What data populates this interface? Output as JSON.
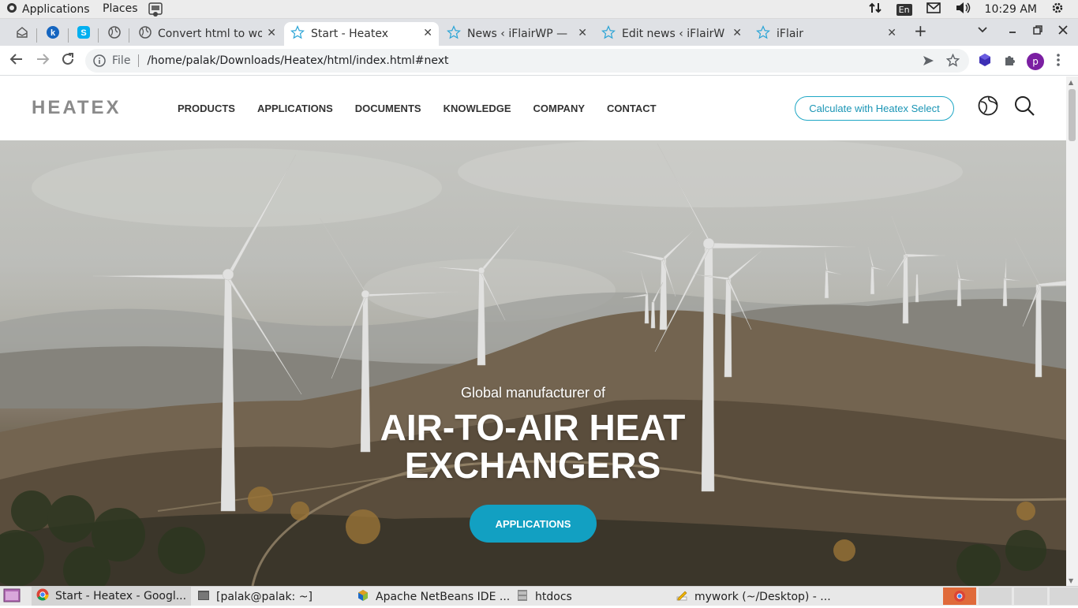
{
  "topbar": {
    "applications": "Applications",
    "places": "Places",
    "lang": "En",
    "time": "10:29 AM"
  },
  "tabs": [
    {
      "title": "Convert html to wo",
      "icon": "globe-icon"
    },
    {
      "title": "Start - Heatex",
      "icon": "star-icon",
      "active": true
    },
    {
      "title": "News ‹ iFlairWP — V",
      "icon": "star-icon"
    },
    {
      "title": "Edit news ‹ iFlairWP",
      "icon": "star-icon"
    },
    {
      "title": "iFlair",
      "icon": "star-icon"
    }
  ],
  "omnibox": {
    "scheme": "File",
    "url": "/home/palak/Downloads/Heatex/html/index.html#next"
  },
  "profile": {
    "initial": "p",
    "color": "#7b1fa2"
  },
  "site": {
    "logo": "HEATEX",
    "nav": [
      "PRODUCTS",
      "APPLICATIONS",
      "DOCUMENTS",
      "KNOWLEDGE",
      "COMPANY",
      "CONTACT"
    ],
    "calc_button": "Calculate with Heatex Select",
    "accent": "#12a0c2"
  },
  "hero": {
    "subtitle": "Global manufacturer of",
    "title": "AIR-TO-AIR HEAT EXCHANGERS",
    "cta": "APPLICATIONS"
  },
  "taskbar": [
    "Start - Heatex - Googl...",
    "[palak@palak: ~]",
    "Apache NetBeans IDE ...",
    "htdocs",
    "mywork (~/Desktop) - ..."
  ]
}
